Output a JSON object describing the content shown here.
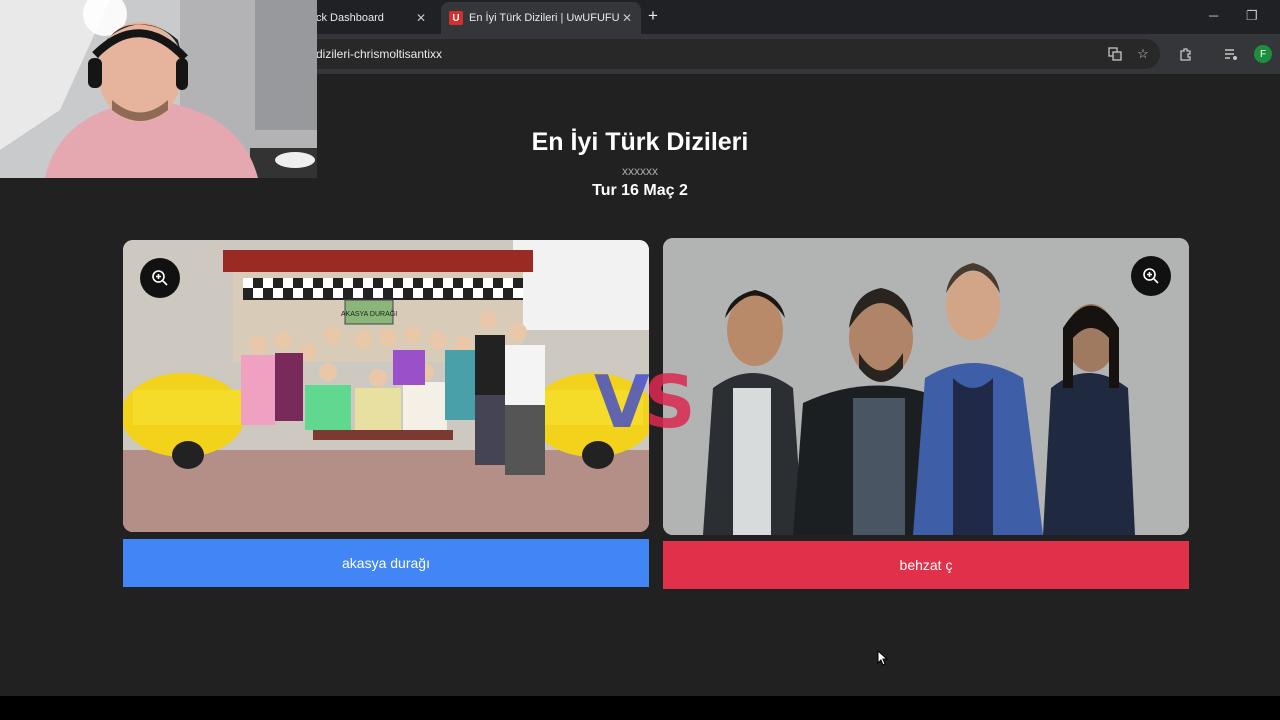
{
  "browser": {
    "tabs": [
      {
        "label": "ck Dashboard"
      },
      {
        "label": "En İyi Türk Dizileri | UwUFUFU",
        "favicon": "U"
      }
    ],
    "close_glyph": "✕",
    "new_tab_glyph": "+",
    "minimize_glyph": "─",
    "restore_glyph": "❐",
    "url": "dizileri-chrismoltisantixx",
    "profile_initial": "F"
  },
  "page": {
    "title": "En İyi Türk Dizileri",
    "subtitle": "xxxxxx",
    "round": "Tur 16 Maç 2",
    "vs_v": "V",
    "vs_s": "S"
  },
  "choices": [
    {
      "label": "akasya durağı",
      "color": "#4285f4"
    },
    {
      "label": "behzat ç",
      "color": "#e0304a"
    }
  ],
  "photo_sign": "AKASYA DURAĞI",
  "colors": {
    "page_bg": "#212121",
    "tab_bar": "#202124",
    "toolbar": "#35363a"
  }
}
